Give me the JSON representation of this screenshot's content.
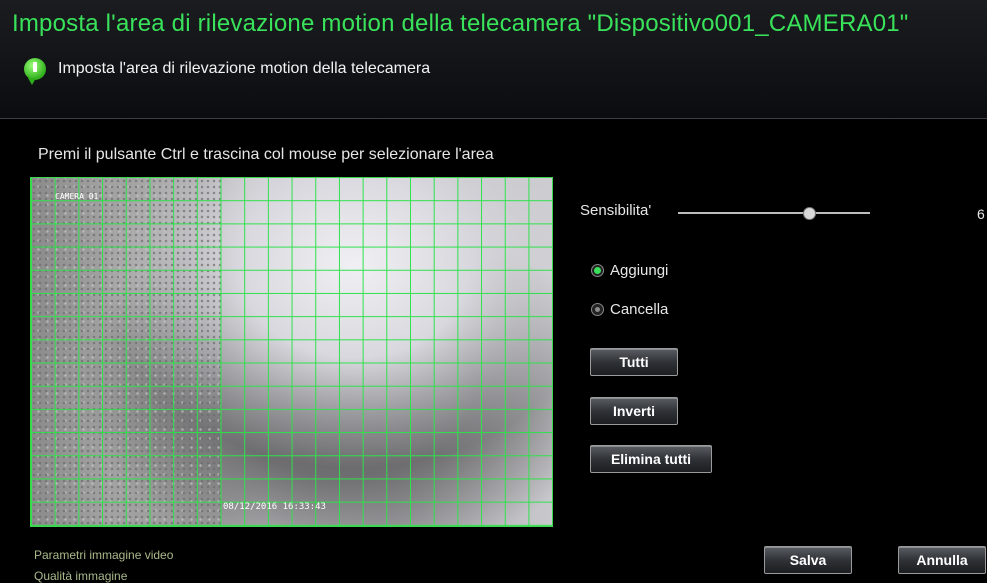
{
  "window": {
    "title": "Imposta l'area di rilevazione motion della telecamera \"Dispositivo001_CAMERA01\"",
    "subtitle": "Imposta l'area di rilevazione motion della telecamera"
  },
  "panel": {
    "instruction": "Premi il pulsante Ctrl e trascina col mouse per selezionare l'area",
    "camera_osd_name": "CAMERA 01",
    "camera_osd_timestamp": "08/12/2016 16:33:43",
    "sensitivity": {
      "label": "Sensibilita'",
      "value": "6"
    },
    "mode_options": [
      {
        "label": "Aggiungi",
        "selected": true
      },
      {
        "label": "Cancella",
        "selected": false
      }
    ],
    "buttons": {
      "all": "Tutti",
      "invert": "Inverti",
      "clear_all": "Elimina tutti"
    }
  },
  "footer": {
    "section_link": "Parametri immagine video",
    "quality_link": "Qualità immagine",
    "save": "Salva",
    "cancel": "Annulla"
  },
  "colors": {
    "accent_green": "#39e25a",
    "grid_green": "#2ee24a"
  }
}
